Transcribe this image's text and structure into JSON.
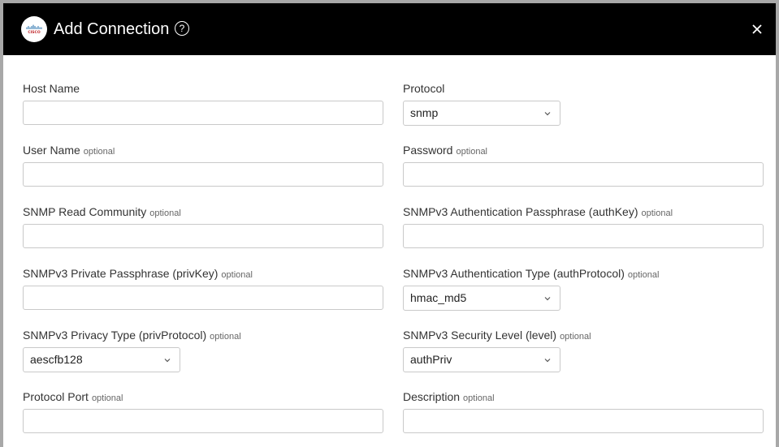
{
  "header": {
    "title": "Add Connection",
    "help_symbol": "?",
    "logo_text": "CISCO"
  },
  "form": {
    "host_name": {
      "label": "Host Name",
      "value": ""
    },
    "protocol": {
      "label": "Protocol",
      "value": "snmp"
    },
    "user_name": {
      "label": "User Name",
      "optional": "optional",
      "value": ""
    },
    "password": {
      "label": "Password",
      "optional": "optional",
      "value": ""
    },
    "snmp_read_community": {
      "label": "SNMP Read Community",
      "optional": "optional",
      "value": ""
    },
    "auth_key": {
      "label": "SNMPv3 Authentication Passphrase (authKey)",
      "optional": "optional",
      "value": ""
    },
    "priv_key": {
      "label": "SNMPv3 Private Passphrase (privKey)",
      "optional": "optional",
      "value": ""
    },
    "auth_protocol": {
      "label": "SNMPv3 Authentication Type (authProtocol)",
      "optional": "optional",
      "value": "hmac_md5"
    },
    "priv_protocol": {
      "label": "SNMPv3 Privacy Type (privProtocol)",
      "optional": "optional",
      "value": "aescfb128"
    },
    "security_level": {
      "label": "SNMPv3 Security Level (level)",
      "optional": "optional",
      "value": "authPriv"
    },
    "protocol_port": {
      "label": "Protocol Port",
      "optional": "optional",
      "value": ""
    },
    "description": {
      "label": "Description",
      "optional": "optional",
      "value": ""
    }
  },
  "icons": {
    "logo": "cisco-logo-icon",
    "help": "help-circle-icon",
    "close": "close-icon",
    "dropdown": "chevron-down-icon"
  },
  "colors": {
    "header_bg": "#000000",
    "frame": "#a8a8a8",
    "border": "#c9c9c9"
  }
}
